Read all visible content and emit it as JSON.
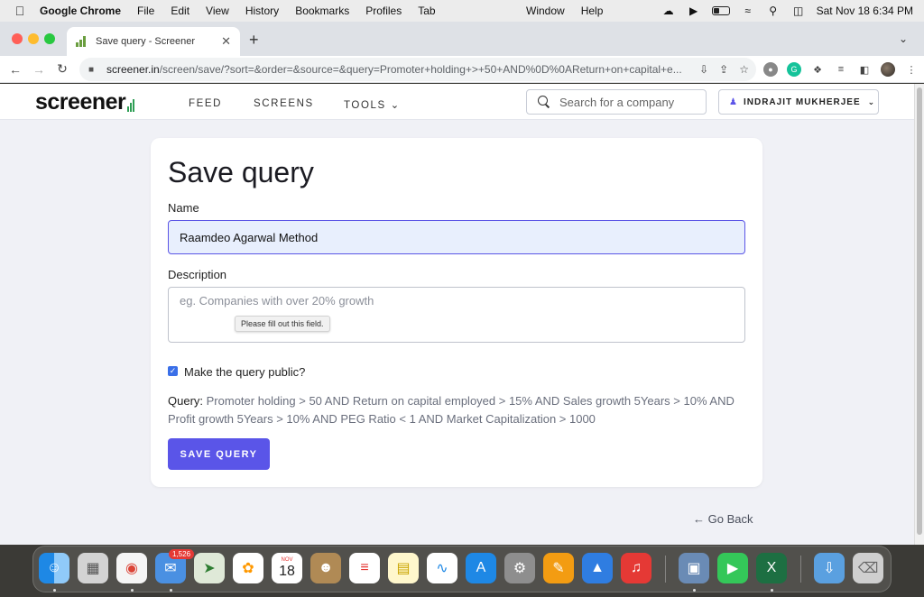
{
  "menubar": {
    "app": "Google Chrome",
    "items": [
      "File",
      "Edit",
      "View",
      "History",
      "Bookmarks",
      "Profiles",
      "Tab"
    ],
    "mid_items": [
      "Window",
      "Help"
    ],
    "clock": "Sat Nov 18  6:34 PM",
    "battery_level": 0.45
  },
  "browser": {
    "tab_title": "Save query - Screener",
    "url_host": "screener.in",
    "url_path": "/screen/save/?sort=&order=&source=&query=Promoter+holding+>+50+AND%0D%0AReturn+on+capital+e..."
  },
  "site": {
    "logo": "screener",
    "nav": [
      "FEED",
      "SCREENS",
      "TOOLS"
    ],
    "search_placeholder": "Search for a company",
    "user": "INDRAJIT MUKHERJEE"
  },
  "form": {
    "title": "Save query",
    "name_label": "Name",
    "name_value": "Raamdeo Agarwal Method",
    "description_label": "Description",
    "description_placeholder": "eg. Companies with over 20% growth",
    "tooltip": "Please fill out this field.",
    "public_label": "Make the query public?",
    "public_checked": true,
    "query_label": "Query:",
    "query_text": "Promoter holding > 50 AND Return on capital employed > 15% AND Sales growth 5Years > 10% AND Profit growth 5Years > 10% AND PEG Ratio < 1 AND Market Capitalization > 1000",
    "save_button": "SAVE QUERY"
  },
  "footer": {
    "go_back": "Go Back"
  },
  "dock": {
    "mail_badge": "1,526",
    "calendar_month": "NOV",
    "calendar_day": "18"
  }
}
